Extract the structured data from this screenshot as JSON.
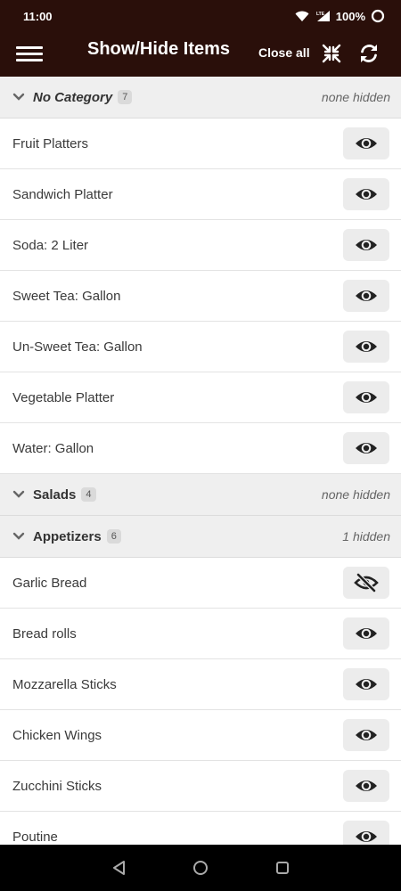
{
  "status_bar": {
    "time": "11:00",
    "network": "LTE",
    "battery": "100%"
  },
  "app_bar": {
    "title": "Show/Hide Items",
    "close_all_label": "Close all"
  },
  "categories": [
    {
      "name": "No Category",
      "count": "7",
      "hidden_info": "none hidden",
      "expanded": true,
      "items": [
        {
          "name": "Fruit Platters",
          "hidden": false
        },
        {
          "name": "Sandwich Platter",
          "hidden": false
        },
        {
          "name": "Soda: 2 Liter",
          "hidden": false
        },
        {
          "name": "Sweet Tea: Gallon",
          "hidden": false
        },
        {
          "name": "Un-Sweet Tea: Gallon",
          "hidden": false
        },
        {
          "name": "Vegetable Platter",
          "hidden": false
        },
        {
          "name": "Water: Gallon",
          "hidden": false
        }
      ]
    },
    {
      "name": "Salads",
      "count": "4",
      "hidden_info": "none hidden",
      "expanded": false,
      "items": []
    },
    {
      "name": "Appetizers",
      "count": "6",
      "hidden_info": "1 hidden",
      "expanded": true,
      "items": [
        {
          "name": "Garlic Bread",
          "hidden": true
        },
        {
          "name": "Bread rolls",
          "hidden": false
        },
        {
          "name": "Mozzarella Sticks",
          "hidden": false
        },
        {
          "name": "Chicken Wings",
          "hidden": false
        },
        {
          "name": "Zucchini Sticks",
          "hidden": false
        },
        {
          "name": "Poutine",
          "hidden": false
        }
      ]
    }
  ],
  "icons": {
    "menu": "hamburger-menu-icon",
    "collapse": "collapse-arrows-icon",
    "refresh": "refresh-icon",
    "visible": "eye-icon",
    "hidden": "eye-slash-icon",
    "chevron": "chevron-down-icon"
  },
  "colors": {
    "app_bar_bg": "#2a0f0a",
    "category_bg": "#efefef",
    "button_bg": "#ececec",
    "icon_dark": "#222222"
  }
}
